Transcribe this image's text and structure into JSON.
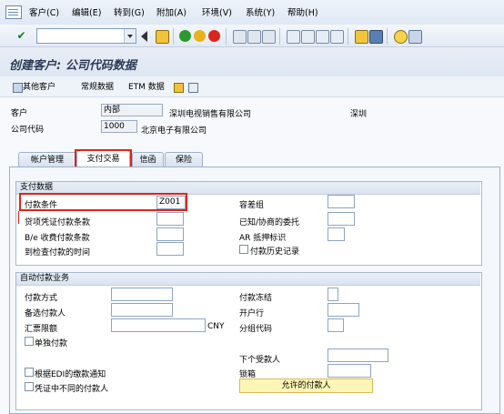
{
  "menu": [
    "客户(C)",
    "编辑(E)",
    "转到(G)",
    "附加(A)",
    "环境(V)",
    "系统(Y)",
    "帮助(H)"
  ],
  "title": "创建客户: 公司代码数据",
  "app_toolbar": {
    "other_customer": "其他客户",
    "general_data": "常规数据",
    "etm_data": "ETM 数据"
  },
  "header": {
    "customer_label": "客户",
    "customer_value": "内部",
    "customer_name": "深圳电视销售有限公司",
    "city": "深圳",
    "company_label": "公司代码",
    "company_value": "1000",
    "company_name": "北京电子有限公司"
  },
  "tabs": [
    "帐户管理",
    "支付交易",
    "信函",
    "保险"
  ],
  "active_tab": "支付交易",
  "payment_data": {
    "heading": "支付数据",
    "terms_label": "付款条件",
    "terms_value": "Z001",
    "tolerance_label": "容差组",
    "credit_memo_label": "贷项凭证付款条款",
    "known_leave_label": "已知/协商的委托",
    "be_terms_label": "B/e 收费付款条款",
    "ar_pledge_label": "AR 抵押标识",
    "check_time_label": "到检查付款的时间",
    "payment_history_label": "付款历史记录"
  },
  "auto_payment": {
    "heading": "自动付款业务",
    "methods_label": "付款方式",
    "payment_block_label": "付款冻结",
    "alt_payee_label": "备选付款人",
    "house_bank_label": "开户行",
    "exchange_limit_label": "汇票限额",
    "currency": "CNY",
    "grouping_key_label": "分组代码",
    "single_payment_label": "单独付款",
    "next_payee_label": "下个受款人",
    "edi_advice_label": "根据EDI的缴款通知",
    "lockbox_label": "锁箱",
    "diff_payee_label": "凭证中不同的付款人",
    "allowed_payees_button": "允许的付款人"
  },
  "colors": {
    "highlight_box": "#e2231a",
    "accent": "#2b3b56"
  }
}
